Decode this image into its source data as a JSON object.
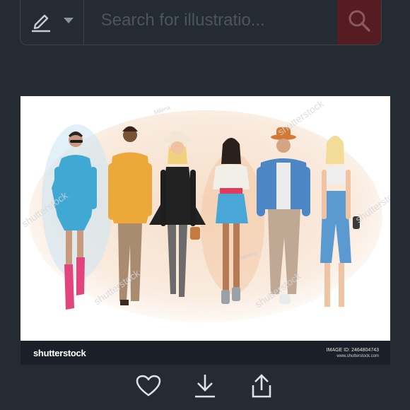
{
  "search": {
    "placeholder": "Search for illustratio...",
    "type_icon": "pen-icon",
    "type_dropdown_icon": "chevron-down-icon",
    "button_icon": "search-icon"
  },
  "image": {
    "brand": "shutterstock",
    "watermark": "shutterstock",
    "watermark_small": "Milena",
    "image_id": "IMAGE ID: 2464804743",
    "site": "www.shutterstock.com"
  },
  "actions": {
    "like_icon": "heart-icon",
    "download_icon": "download-icon",
    "share_icon": "share-icon"
  },
  "colors": {
    "background": "#252b33",
    "search_button": "#571b22",
    "card_footer": "#1b2028"
  }
}
